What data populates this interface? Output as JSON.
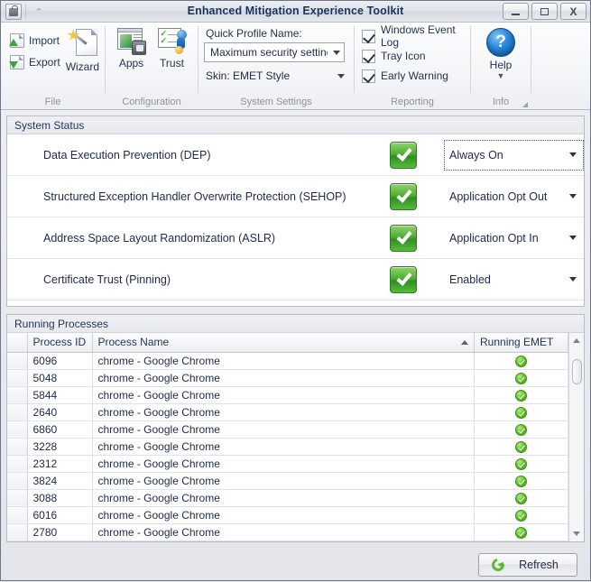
{
  "window": {
    "title": "Enhanced Mitigation Experience Toolkit",
    "minimize_label": "_",
    "maximize_label": "□",
    "close_label": "X",
    "quick_access_icon": "emet-lock-icon",
    "customize_chevron": "⌃"
  },
  "ribbon": {
    "groups": [
      {
        "caption": "File",
        "buttons": [
          {
            "label": "Import",
            "icon": "import-document-icon"
          },
          {
            "label": "Export",
            "icon": "export-document-icon"
          },
          {
            "label": "Wizard",
            "icon": "wizard-wand-icon"
          }
        ]
      },
      {
        "caption": "Configuration",
        "buttons": [
          {
            "label": "Apps",
            "icon": "apps-window-icon"
          },
          {
            "label": "Trust",
            "icon": "trust-certificate-icon"
          }
        ]
      },
      {
        "caption": "System Settings",
        "quick_profile_label": "Quick Profile Name:",
        "quick_profile_value": "Maximum security settings",
        "skin_value": "Skin: EMET Style"
      },
      {
        "caption": "Reporting",
        "checkboxes": [
          {
            "label": "Windows Event Log",
            "checked": true
          },
          {
            "label": "Tray Icon",
            "checked": true
          },
          {
            "label": "Early Warning",
            "checked": true
          }
        ]
      },
      {
        "caption": "Info",
        "help_label": "Help",
        "help_icon": "help-question-icon"
      }
    ]
  },
  "system_status": {
    "title": "System Status",
    "rows": [
      {
        "name": "Data Execution Prevention (DEP)",
        "status_icon": "green-check-icon",
        "setting": "Always On",
        "focused": true
      },
      {
        "name": "Structured Exception Handler Overwrite Protection (SEHOP)",
        "status_icon": "green-check-icon",
        "setting": "Application Opt Out",
        "focused": false
      },
      {
        "name": "Address Space Layout Randomization (ASLR)",
        "status_icon": "green-check-icon",
        "setting": "Application Opt In",
        "focused": false
      },
      {
        "name": "Certificate Trust (Pinning)",
        "status_icon": "green-check-icon",
        "setting": "Enabled",
        "focused": false
      }
    ]
  },
  "running_processes": {
    "title": "Running Processes",
    "columns": [
      "Process ID",
      "Process Name",
      "Running EMET"
    ],
    "sort_column": "Process Name",
    "sort_direction": "ascending",
    "rows": [
      {
        "pid": "6096",
        "name": "chrome - Google Chrome",
        "emet": "green-check-circle-icon"
      },
      {
        "pid": "5048",
        "name": "chrome - Google Chrome",
        "emet": "green-check-circle-icon"
      },
      {
        "pid": "5844",
        "name": "chrome - Google Chrome",
        "emet": "green-check-circle-icon"
      },
      {
        "pid": "2640",
        "name": "chrome - Google Chrome",
        "emet": "green-check-circle-icon"
      },
      {
        "pid": "6860",
        "name": "chrome - Google Chrome",
        "emet": "green-check-circle-icon"
      },
      {
        "pid": "3228",
        "name": "chrome - Google Chrome",
        "emet": "green-check-circle-icon"
      },
      {
        "pid": "2312",
        "name": "chrome - Google Chrome",
        "emet": "green-check-circle-icon"
      },
      {
        "pid": "3824",
        "name": "chrome - Google Chrome",
        "emet": "green-check-circle-icon"
      },
      {
        "pid": "3088",
        "name": "chrome - Google Chrome",
        "emet": "green-check-circle-icon"
      },
      {
        "pid": "6016",
        "name": "chrome - Google Chrome",
        "emet": "green-check-circle-icon"
      },
      {
        "pid": "2780",
        "name": "chrome - Google Chrome",
        "emet": "green-check-circle-icon"
      }
    ]
  },
  "footer": {
    "refresh_label": "Refresh",
    "refresh_icon": "refresh-circular-arrow-icon"
  },
  "colors": {
    "accent_green": "#4fae34",
    "title_text": "#16355e",
    "window_bg": "#e9eaee",
    "group_border": "#b7bcc6"
  }
}
